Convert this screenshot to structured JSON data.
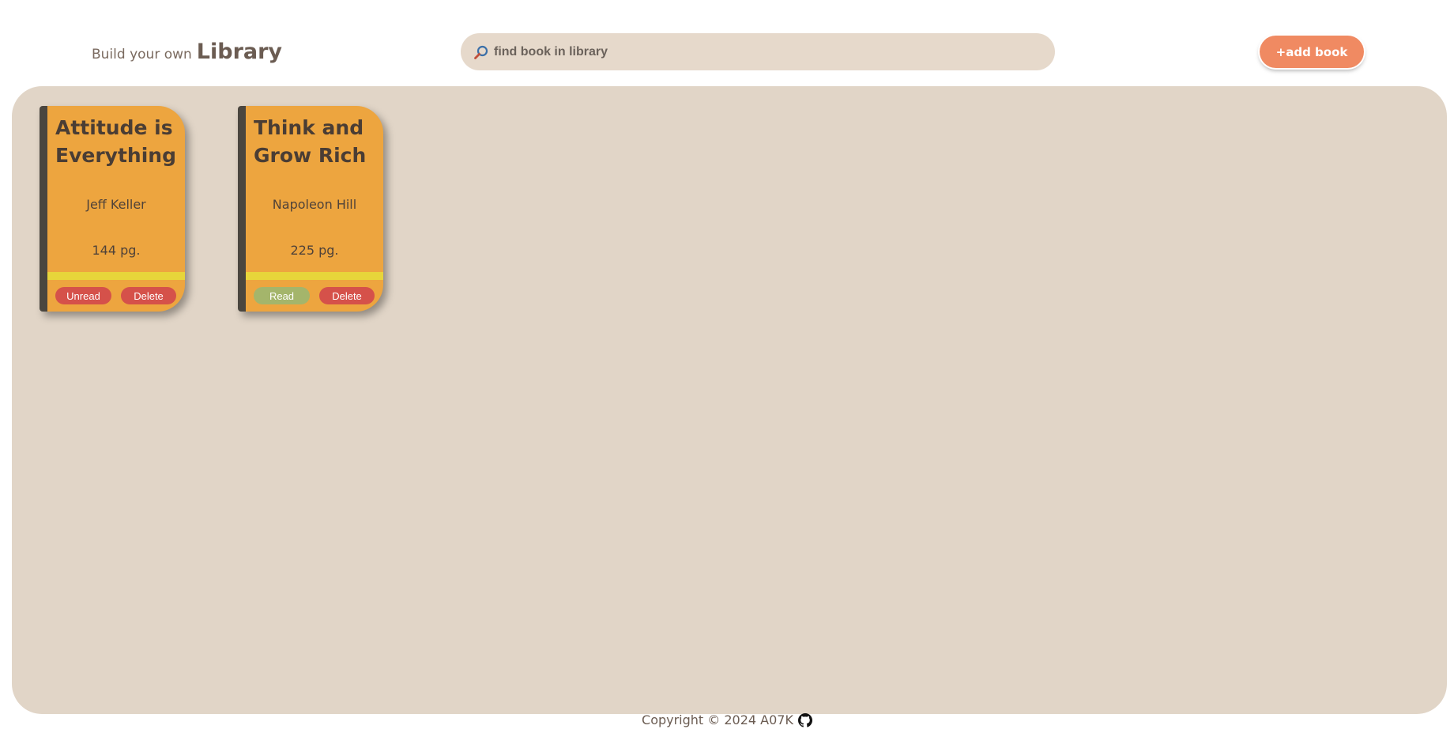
{
  "header": {
    "brand_prefix": "Build your own",
    "brand_name": "Library",
    "search_placeholder": "find book in library",
    "add_button_label": "+add book"
  },
  "books": [
    {
      "title": "Attitude is Everything",
      "author": "Jeff Keller",
      "pages": "144 pg.",
      "status_label": "Unread",
      "delete_label": "Delete"
    },
    {
      "title": "Think and Grow Rich",
      "author": "Napoleon Hill",
      "pages": "225 pg.",
      "status_label": "Read",
      "delete_label": "Delete"
    }
  ],
  "footer": {
    "copyright": "Copyright © 2024 A07K",
    "icon": "github-icon"
  },
  "colors": {
    "accent": "#f08a62",
    "library_bg": "#e1d5c7",
    "book_bg": "#eda53f",
    "spine": "#4a463f",
    "band": "#e7d53a",
    "unread": "#d5514a",
    "read": "#a4b56b",
    "delete": "#d5514a"
  }
}
